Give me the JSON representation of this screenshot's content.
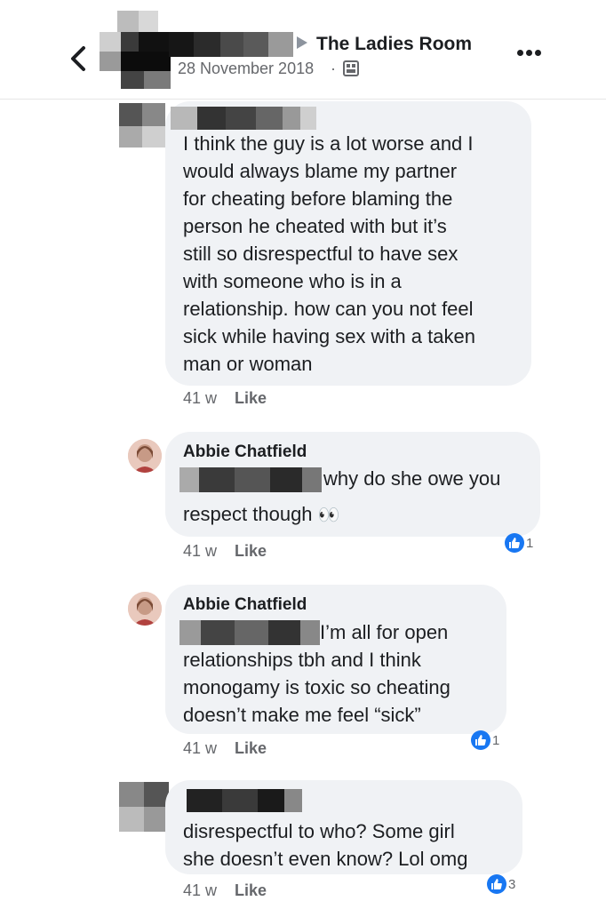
{
  "header": {
    "group_name": "The Ladies Room",
    "date": "28 November 2018",
    "separator": "·"
  },
  "comments": [
    {
      "author": "",
      "lines": [
        "I think the guy is a lot worse and I",
        "would always blame my partner",
        "for cheating before blaming the",
        "person he cheated with but it’s",
        "still so disrespectful to have sex",
        "with someone who is in a",
        "relationship. how can you not feel",
        "sick while having sex with a taken",
        "man or woman"
      ],
      "time": "41 w",
      "like": "Like",
      "reactions": ""
    },
    {
      "author": "Abbie Chatfield",
      "lines": [
        "why do she owe you",
        "respect though"
      ],
      "emoji": "👀",
      "time": "41 w",
      "like": "Like",
      "reactions": "1"
    },
    {
      "author": "Abbie Chatfield",
      "lines": [
        "I’m all for open",
        "relationships tbh and I think",
        "monogamy is toxic so cheating",
        "doesn’t make me feel “sick”"
      ],
      "time": "41 w",
      "like": "Like",
      "reactions": "1"
    },
    {
      "author": "",
      "lines": [
        "disrespectful to who? Some girl",
        "she doesn’t even know? Lol omg"
      ],
      "time": "41 w",
      "like": "Like",
      "reactions": "3"
    }
  ],
  "icons": {
    "back": "chevron-left-icon",
    "more": "more-dots-icon",
    "privacy": "group-privacy-icon",
    "reaction": "like-thumb-icon"
  },
  "colors": {
    "bubble": "#f0f2f5",
    "like_blue": "#1877f2",
    "meta_gray": "#65676b"
  }
}
